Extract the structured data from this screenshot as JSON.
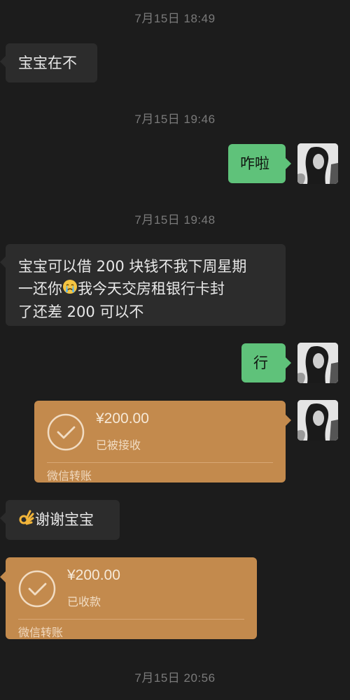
{
  "messages": {
    "ts1": "7月15日 18:49",
    "m1": "宝宝在不",
    "ts2": "7月15日 19:46",
    "m2": "咋啦",
    "ts3": "7月15日 19:48",
    "m3_line1": "宝宝可以借 200 块钱不我下周星期",
    "m3_line2a": "一还你",
    "m3_line2b": "我今天交房租银行卡封",
    "m3_line3": "了还差 200 可以不",
    "m4": "行",
    "transfer1": {
      "amount": "¥200.00",
      "status": "已被接收",
      "label": "微信转账"
    },
    "m5": "谢谢宝宝",
    "transfer2": {
      "amount": "¥200.00",
      "status": "已收款",
      "label": "微信转账"
    },
    "ts4": "7月15日 20:56"
  },
  "colors": {
    "background": "#1c1c1c",
    "incoming_bubble": "#2c2c2c",
    "outgoing_bubble": "#5fc27a",
    "transfer_card": "#c38a4d"
  },
  "icons": {
    "sad_emoji": "crying-face-icon",
    "ok_emoji": "ok-hand-icon",
    "transfer_check": "check-circle-icon"
  }
}
